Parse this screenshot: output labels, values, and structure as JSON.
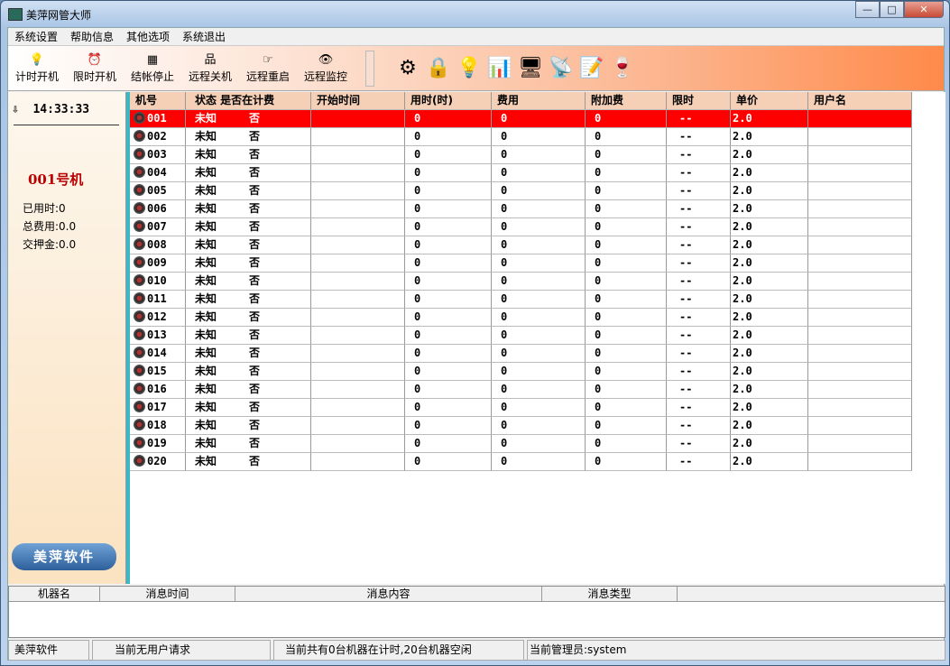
{
  "window": {
    "title": "美萍网管大师",
    "min": "—",
    "max": "□",
    "close": "✕"
  },
  "menu": [
    "系统设置",
    "帮助信息",
    "其他选项",
    "系统退出"
  ],
  "toolbar": [
    {
      "label": "计时开机",
      "icon": "lightbulb-icon",
      "glyph": "💡"
    },
    {
      "label": "限时开机",
      "icon": "alarm-clock-icon",
      "glyph": "⏰"
    },
    {
      "label": "结帐停止",
      "icon": "calculator-icon",
      "glyph": "▦"
    },
    {
      "label": "远程关机",
      "icon": "network-icon",
      "glyph": "品"
    },
    {
      "label": "远程重启",
      "icon": "pointing-hand-icon",
      "glyph": "☞"
    },
    {
      "label": "远程监控",
      "icon": "eye-icon",
      "glyph": "👁"
    }
  ],
  "toolbar_icons": [
    {
      "icon": "settings-gear-icon",
      "glyph": "⚙"
    },
    {
      "icon": "lock-icon",
      "glyph": "🔒"
    },
    {
      "icon": "bulb-icon",
      "glyph": "💡"
    },
    {
      "icon": "bar-chart-icon",
      "glyph": "📊"
    },
    {
      "icon": "computers-icon",
      "glyph": "🖥"
    },
    {
      "icon": "satellite-icon",
      "glyph": "📡"
    },
    {
      "icon": "notes-icon",
      "glyph": "📝"
    },
    {
      "icon": "wine-icon",
      "glyph": "🍷"
    }
  ],
  "left": {
    "time": "14:33:33",
    "machine": "001号机",
    "used_time": "已用时:0",
    "total_fee": "总费用:0.0",
    "deposit": "交押金:0.0",
    "logo": "美萍软件"
  },
  "table": {
    "columns": [
      "机号",
      "状态  是否在计费",
      "开始时间",
      "用时(时)",
      "费用",
      "附加费",
      "限时",
      "单价",
      "用户名"
    ],
    "rows": [
      [
        "001",
        "未知",
        "否",
        "",
        "0",
        "0",
        "0",
        "--",
        "2.0",
        ""
      ],
      [
        "002",
        "未知",
        "否",
        "",
        "0",
        "0",
        "0",
        "--",
        "2.0",
        ""
      ],
      [
        "003",
        "未知",
        "否",
        "",
        "0",
        "0",
        "0",
        "--",
        "2.0",
        ""
      ],
      [
        "004",
        "未知",
        "否",
        "",
        "0",
        "0",
        "0",
        "--",
        "2.0",
        ""
      ],
      [
        "005",
        "未知",
        "否",
        "",
        "0",
        "0",
        "0",
        "--",
        "2.0",
        ""
      ],
      [
        "006",
        "未知",
        "否",
        "",
        "0",
        "0",
        "0",
        "--",
        "2.0",
        ""
      ],
      [
        "007",
        "未知",
        "否",
        "",
        "0",
        "0",
        "0",
        "--",
        "2.0",
        ""
      ],
      [
        "008",
        "未知",
        "否",
        "",
        "0",
        "0",
        "0",
        "--",
        "2.0",
        ""
      ],
      [
        "009",
        "未知",
        "否",
        "",
        "0",
        "0",
        "0",
        "--",
        "2.0",
        ""
      ],
      [
        "010",
        "未知",
        "否",
        "",
        "0",
        "0",
        "0",
        "--",
        "2.0",
        ""
      ],
      [
        "011",
        "未知",
        "否",
        "",
        "0",
        "0",
        "0",
        "--",
        "2.0",
        ""
      ],
      [
        "012",
        "未知",
        "否",
        "",
        "0",
        "0",
        "0",
        "--",
        "2.0",
        ""
      ],
      [
        "013",
        "未知",
        "否",
        "",
        "0",
        "0",
        "0",
        "--",
        "2.0",
        ""
      ],
      [
        "014",
        "未知",
        "否",
        "",
        "0",
        "0",
        "0",
        "--",
        "2.0",
        ""
      ],
      [
        "015",
        "未知",
        "否",
        "",
        "0",
        "0",
        "0",
        "--",
        "2.0",
        ""
      ],
      [
        "016",
        "未知",
        "否",
        "",
        "0",
        "0",
        "0",
        "--",
        "2.0",
        ""
      ],
      [
        "017",
        "未知",
        "否",
        "",
        "0",
        "0",
        "0",
        "--",
        "2.0",
        ""
      ],
      [
        "018",
        "未知",
        "否",
        "",
        "0",
        "0",
        "0",
        "--",
        "2.0",
        ""
      ],
      [
        "019",
        "未知",
        "否",
        "",
        "0",
        "0",
        "0",
        "--",
        "2.0",
        ""
      ],
      [
        "020",
        "未知",
        "否",
        "",
        "0",
        "0",
        "0",
        "--",
        "2.0",
        ""
      ]
    ]
  },
  "messages": {
    "columns": [
      "机器名",
      "消息时间",
      "消息内容",
      "消息类型",
      ""
    ]
  },
  "status": [
    "美萍软件",
    "当前无用户请求",
    "当前共有0台机器在计时,20台机器空闲",
    "当前管理员:system"
  ]
}
